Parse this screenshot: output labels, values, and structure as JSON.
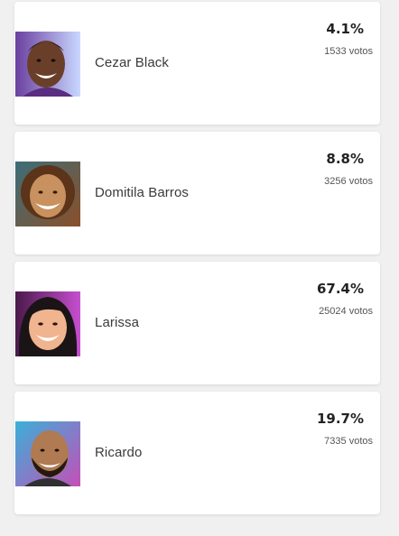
{
  "candidates": [
    {
      "name": "Cezar Black",
      "percent": "4.1%",
      "votes": "1533 votos",
      "photo_icon": "person-photo-icon",
      "bg_colors": [
        "#6b3fa0",
        "#c9d8ff"
      ],
      "skin": "#6a3f2a",
      "hair": "#2a1a12"
    },
    {
      "name": "Domitila Barros",
      "percent": "8.8%",
      "votes": "3256 votos",
      "photo_icon": "person-photo-icon",
      "bg_colors": [
        "#3c6e78",
        "#8a4f2a"
      ],
      "skin": "#c8915f",
      "hair": "#5b3419"
    },
    {
      "name": "Larissa",
      "percent": "67.4%",
      "votes": "25024 votos",
      "photo_icon": "person-photo-icon",
      "bg_colors": [
        "#4a1a4a",
        "#c64fd0"
      ],
      "skin": "#f0b48f",
      "hair": "#1b1416"
    },
    {
      "name": "Ricardo",
      "percent": "19.7%",
      "votes": "7335 votos",
      "photo_icon": "person-photo-icon",
      "bg_colors": [
        "#3ab0d8",
        "#c44fb8"
      ],
      "skin": "#b07a52",
      "hair": "#241812"
    }
  ]
}
